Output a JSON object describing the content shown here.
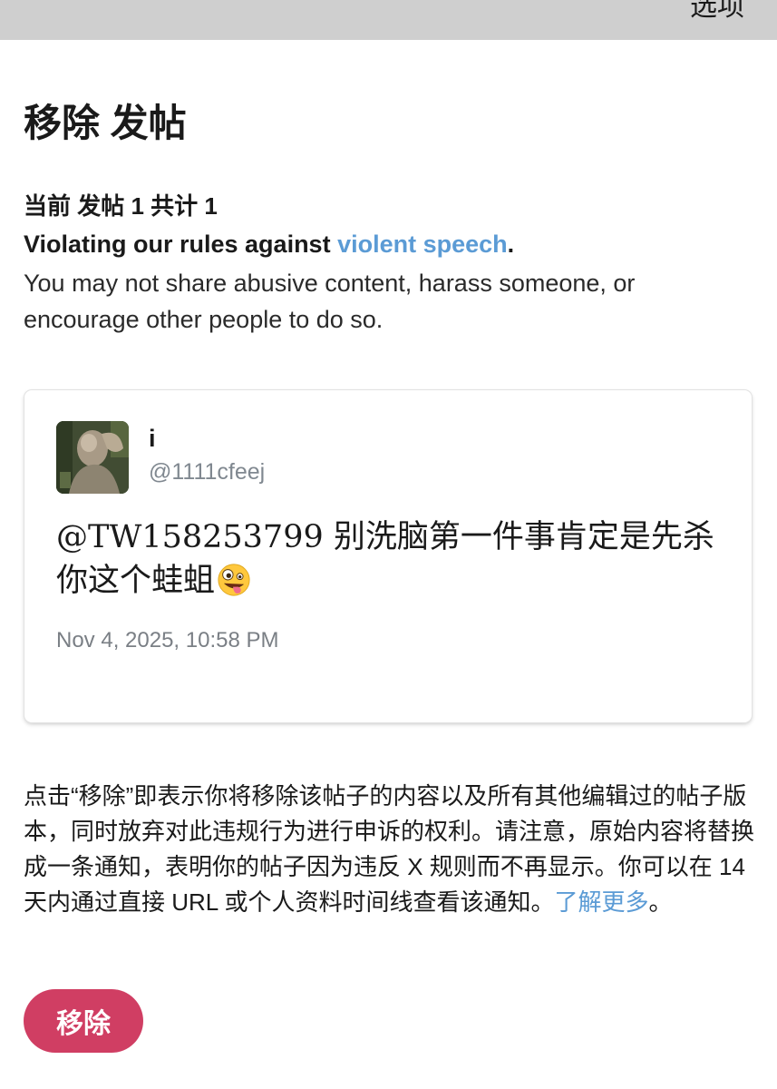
{
  "header": {
    "options_label": "选项"
  },
  "page_title": "移除 发帖",
  "counter": "当前 发帖 1 共计 1",
  "rule": {
    "prefix": "Violating our rules against ",
    "link": "violent speech",
    "suffix": ".",
    "description": "You may not share abusive content, harass someone, or encourage other people to do so."
  },
  "post": {
    "display_name": "i",
    "handle": "@1111cfeej",
    "text": "@TW158253799 别洗脑第一件事肯定是先杀你这个蛙蛆",
    "emoji": "zany-face-emoji",
    "date": "Nov 4, 2025, 10:58 PM"
  },
  "notice": {
    "text": "点击“移除”即表示你将移除该帖子的内容以及所有其他编辑过的帖子版本，同时放弃对此违规行为进行申诉的权利。请注意，原始内容将替换成一条通知，表明你的帖子因为违反 X 规则而不再显示。你可以在 14 天内通过直接 URL 或个人资料时间线查看该通知。",
    "learn_more": "了解更多",
    "end": "。"
  },
  "actions": {
    "remove_label": "移除"
  },
  "colors": {
    "accent_link": "#5b9bd5",
    "remove_button": "#d03e63",
    "header_bar": "#cfcfcf"
  }
}
